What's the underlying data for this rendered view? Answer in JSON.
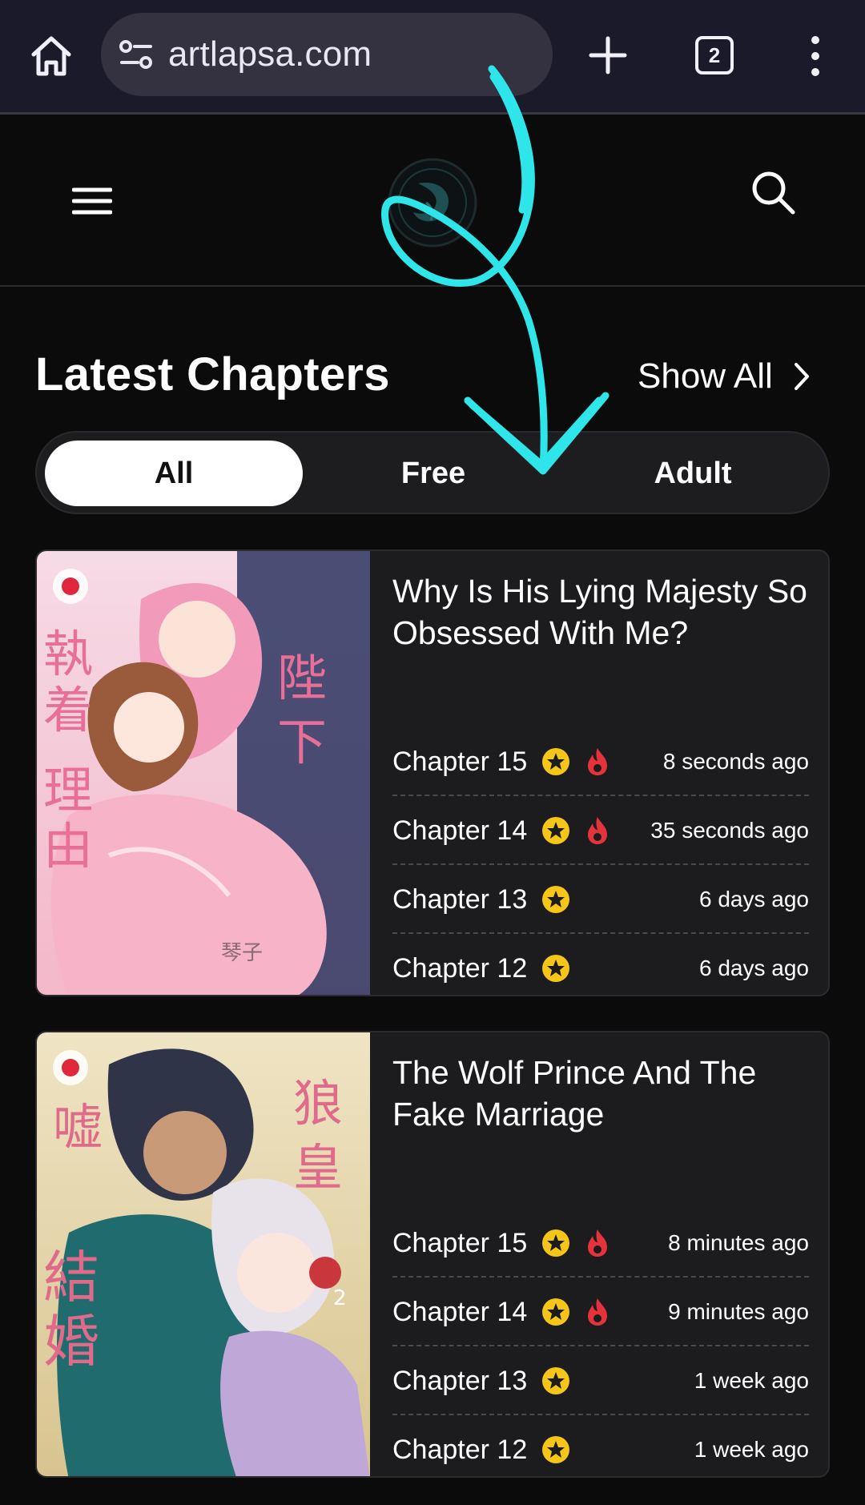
{
  "browser": {
    "url": "artlapsa.com",
    "tab_count": "2",
    "icons": [
      "home-icon",
      "site-settings-icon",
      "new-tab-icon",
      "tab-switcher-icon",
      "more-menu-icon"
    ]
  },
  "header": {
    "icons": [
      "hamburger-menu-icon",
      "site-logo",
      "search-icon"
    ]
  },
  "section": {
    "title": "Latest Chapters",
    "show_all": "Show All"
  },
  "filters": {
    "tabs": [
      {
        "label": "All",
        "active": true
      },
      {
        "label": "Free",
        "active": false
      },
      {
        "label": "Adult",
        "active": false
      }
    ]
  },
  "series": [
    {
      "title": "Why Is His Lying Majesty So Obsessed With Me?",
      "chapters": [
        {
          "label": "Chapter 15",
          "premium": true,
          "hot": true,
          "time": "8 seconds ago"
        },
        {
          "label": "Chapter 14",
          "premium": true,
          "hot": true,
          "time": "35 seconds ago"
        },
        {
          "label": "Chapter 13",
          "premium": true,
          "hot": false,
          "time": "6 days ago"
        },
        {
          "label": "Chapter 12",
          "premium": true,
          "hot": false,
          "time": "6 days ago"
        }
      ]
    },
    {
      "title": "The Wolf Prince And The Fake Marriage",
      "chapters": [
        {
          "label": "Chapter 15",
          "premium": true,
          "hot": true,
          "time": "8 minutes ago"
        },
        {
          "label": "Chapter 14",
          "premium": true,
          "hot": true,
          "time": "9 minutes ago"
        },
        {
          "label": "Chapter 13",
          "premium": true,
          "hot": false,
          "time": "1 week ago"
        },
        {
          "label": "Chapter 12",
          "premium": true,
          "hot": false,
          "time": "1 week ago"
        }
      ]
    }
  ],
  "colors": {
    "accent_annotation": "#2ee6ea",
    "star": "#f5c518",
    "fire": "#e5333b",
    "card_bg": "#1c1c1e"
  }
}
